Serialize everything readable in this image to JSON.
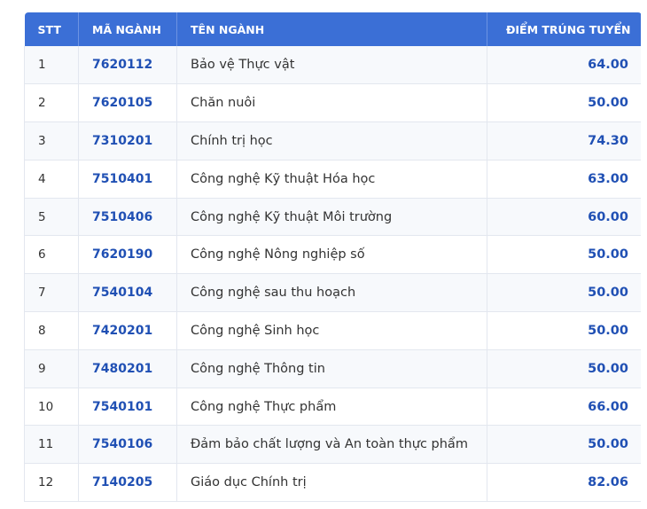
{
  "headers": {
    "stt": "STT",
    "code": "MÃ NGÀNH",
    "name": "TÊN NGÀNH",
    "score": "ĐIỂM TRÚNG TUYỂN"
  },
  "rows": [
    {
      "stt": "1",
      "code": "7620112",
      "name": "Bảo vệ Thực vật",
      "score": "64.00"
    },
    {
      "stt": "2",
      "code": "7620105",
      "name": "Chăn nuôi",
      "score": "50.00"
    },
    {
      "stt": "3",
      "code": "7310201",
      "name": "Chính trị học",
      "score": "74.30"
    },
    {
      "stt": "4",
      "code": "7510401",
      "name": "Công nghệ Kỹ thuật Hóa học",
      "score": "63.00"
    },
    {
      "stt": "5",
      "code": "7510406",
      "name": "Công nghệ Kỹ thuật Môi trường",
      "score": "60.00"
    },
    {
      "stt": "6",
      "code": "7620190",
      "name": "Công nghệ Nông nghiệp số",
      "score": "50.00"
    },
    {
      "stt": "7",
      "code": "7540104",
      "name": "Công nghệ sau thu hoạch",
      "score": "50.00"
    },
    {
      "stt": "8",
      "code": "7420201",
      "name": "Công nghệ Sinh học",
      "score": "50.00"
    },
    {
      "stt": "9",
      "code": "7480201",
      "name": "Công nghệ Thông tin",
      "score": "50.00"
    },
    {
      "stt": "10",
      "code": "7540101",
      "name": "Công nghệ Thực phẩm",
      "score": "66.00"
    },
    {
      "stt": "11",
      "code": "7540106",
      "name": "Đảm bảo chất lượng và An toàn thực phẩm",
      "score": "50.00"
    },
    {
      "stt": "12",
      "code": "7140205",
      "name": "Giáo dục Chính trị",
      "score": "82.06"
    }
  ]
}
